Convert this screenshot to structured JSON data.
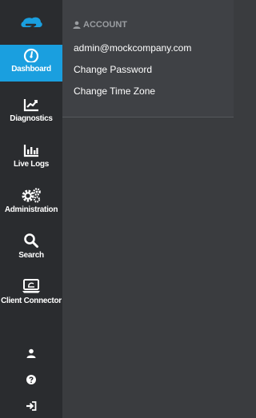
{
  "sidebar": {
    "logo_icon": "zscaler-cloud-logo",
    "items": [
      {
        "label": "Dashboard",
        "icon": "gauge-icon",
        "active": true
      },
      {
        "label": "Diagnostics",
        "icon": "trend-chart-icon",
        "active": false
      },
      {
        "label": "Live Logs",
        "icon": "bar-chart-icon",
        "active": false
      },
      {
        "label": "Administration",
        "icon": "gears-icon",
        "active": false
      },
      {
        "label": "Search",
        "icon": "search-icon",
        "active": false
      },
      {
        "label": "Client Connector",
        "icon": "laptop-icon",
        "active": false
      }
    ],
    "bottom_icons": [
      "user-icon",
      "help-icon",
      "sign-out-icon"
    ]
  },
  "account_menu": {
    "header": "ACCOUNT",
    "header_icon": "user-icon",
    "items": [
      "admin@mockcompany.com",
      "Change Password",
      "Change Time Zone"
    ]
  },
  "colors": {
    "sidebar_bg": "#2a2c2f",
    "active_bg": "#1a9fdf",
    "panel_bg": "#3a3c3f",
    "logo_blue": "#1a9fdf"
  }
}
